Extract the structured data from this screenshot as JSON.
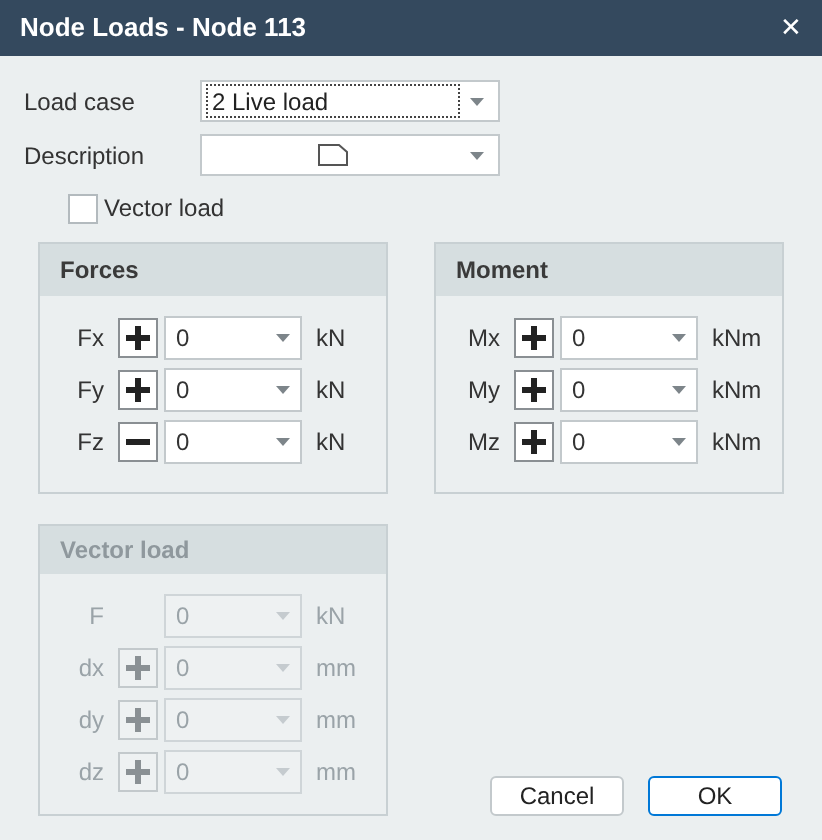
{
  "window": {
    "title": "Node Loads - Node 113",
    "close": "✕"
  },
  "fields": [
    {
      "label": "Load case",
      "value": "2 Live load",
      "focused": true
    },
    {
      "label": "Description",
      "focused": false
    }
  ],
  "vector_load_checkbox": {
    "label": "Vector load",
    "checked": false
  },
  "groups": [
    {
      "title": "Forces",
      "disabled": false,
      "rows": [
        {
          "label": "Fx",
          "kind": "plus",
          "value": "0",
          "unit": "kN"
        },
        {
          "label": "Fy",
          "kind": "plus",
          "value": "0",
          "unit": "kN"
        },
        {
          "label": "Fz",
          "kind": "minus",
          "value": "0",
          "unit": "kN"
        }
      ]
    },
    {
      "title": "Moment",
      "disabled": false,
      "rows": [
        {
          "label": "Mx",
          "kind": "plus",
          "value": "0",
          "unit": "kNm"
        },
        {
          "label": "My",
          "kind": "plus",
          "value": "0",
          "unit": "kNm"
        },
        {
          "label": "Mz",
          "kind": "plus",
          "value": "0",
          "unit": "kNm"
        }
      ]
    },
    {
      "title": "Vector load",
      "disabled": true,
      "rows": [
        {
          "label": "F",
          "kind": "plain",
          "value": "0",
          "unit": "kN"
        },
        {
          "label": "dx",
          "kind": "plus",
          "value": "0",
          "unit": "mm"
        },
        {
          "label": "dy",
          "kind": "plus",
          "value": "0",
          "unit": "mm"
        },
        {
          "label": "dz",
          "kind": "plus",
          "value": "0",
          "unit": "mm"
        }
      ]
    }
  ],
  "buttons": [
    {
      "label": "Cancel",
      "default": false
    },
    {
      "label": "OK",
      "default": true
    }
  ]
}
